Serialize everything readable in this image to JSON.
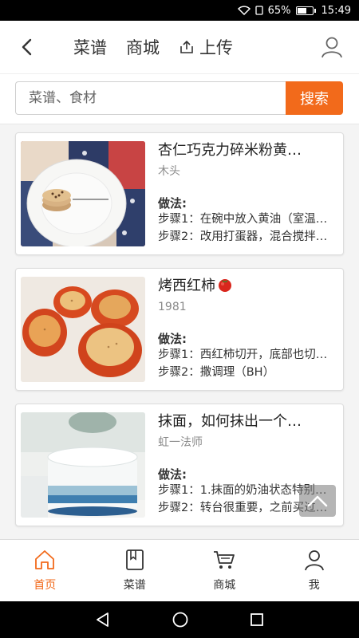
{
  "status_bar": {
    "battery": "65%",
    "time": "15:49",
    "battery_level": 0.65
  },
  "header": {
    "tabs": [
      {
        "label": "菜谱"
      },
      {
        "label": "商城"
      },
      {
        "label": "上传"
      }
    ]
  },
  "search": {
    "placeholder": "菜谱、食材",
    "button_label": "搜索"
  },
  "recipes": [
    {
      "title": "杏仁巧克力碎米粉黄…",
      "author": "木头",
      "method_label": "做法:",
      "step1": "步骤1：在碗中放入黄油（室温…",
      "step2": "步骤2：改用打蛋器，混合搅拌…"
    },
    {
      "title": "烤西红柿",
      "author": "1981",
      "method_label": "做法:",
      "step1": "步骤1：西红柿切开，底部也切…",
      "step2": "步骤2：撒调理（BH）"
    },
    {
      "title": "抹面，如何抹出一个…",
      "author": "虹一法师",
      "method_label": "做法:",
      "step1": "步骤1：1.抹面的奶油状态特别…",
      "step2": "步骤2：转台很重要，之前买过…"
    }
  ],
  "bottom_nav": [
    {
      "label": "首页",
      "icon": "home-icon",
      "active": true
    },
    {
      "label": "菜谱",
      "icon": "book-icon",
      "active": false
    },
    {
      "label": "商城",
      "icon": "cart-icon",
      "active": false
    },
    {
      "label": "我",
      "icon": "user-icon",
      "active": false
    }
  ],
  "colors": {
    "accent": "#f26a1b"
  }
}
